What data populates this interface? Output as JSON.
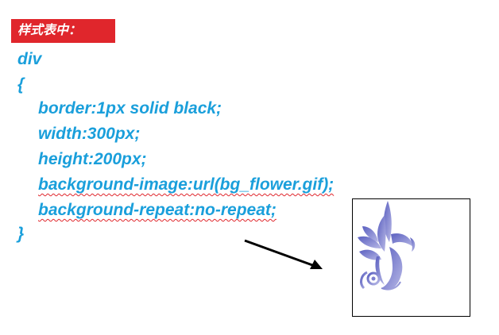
{
  "header": {
    "badge_label": "样式表中："
  },
  "code_lines": [
    "div",
    "{",
    "border:1px solid black;",
    "width:300px;",
    "height:200px;",
    "background-image:url(bg_flower.gif);",
    "background-repeat:no-repeat;",
    "}"
  ],
  "colors": {
    "code_text": "#1a9fdb",
    "badge_bg": "#e0262c",
    "spellcheck_underline": "#e0262c",
    "flower_gradient_start": "#5a5fc0",
    "flower_gradient_end": "#b7b8e6"
  },
  "icons": {
    "arrow": "arrow-right-icon",
    "flower": "flower-icon"
  }
}
